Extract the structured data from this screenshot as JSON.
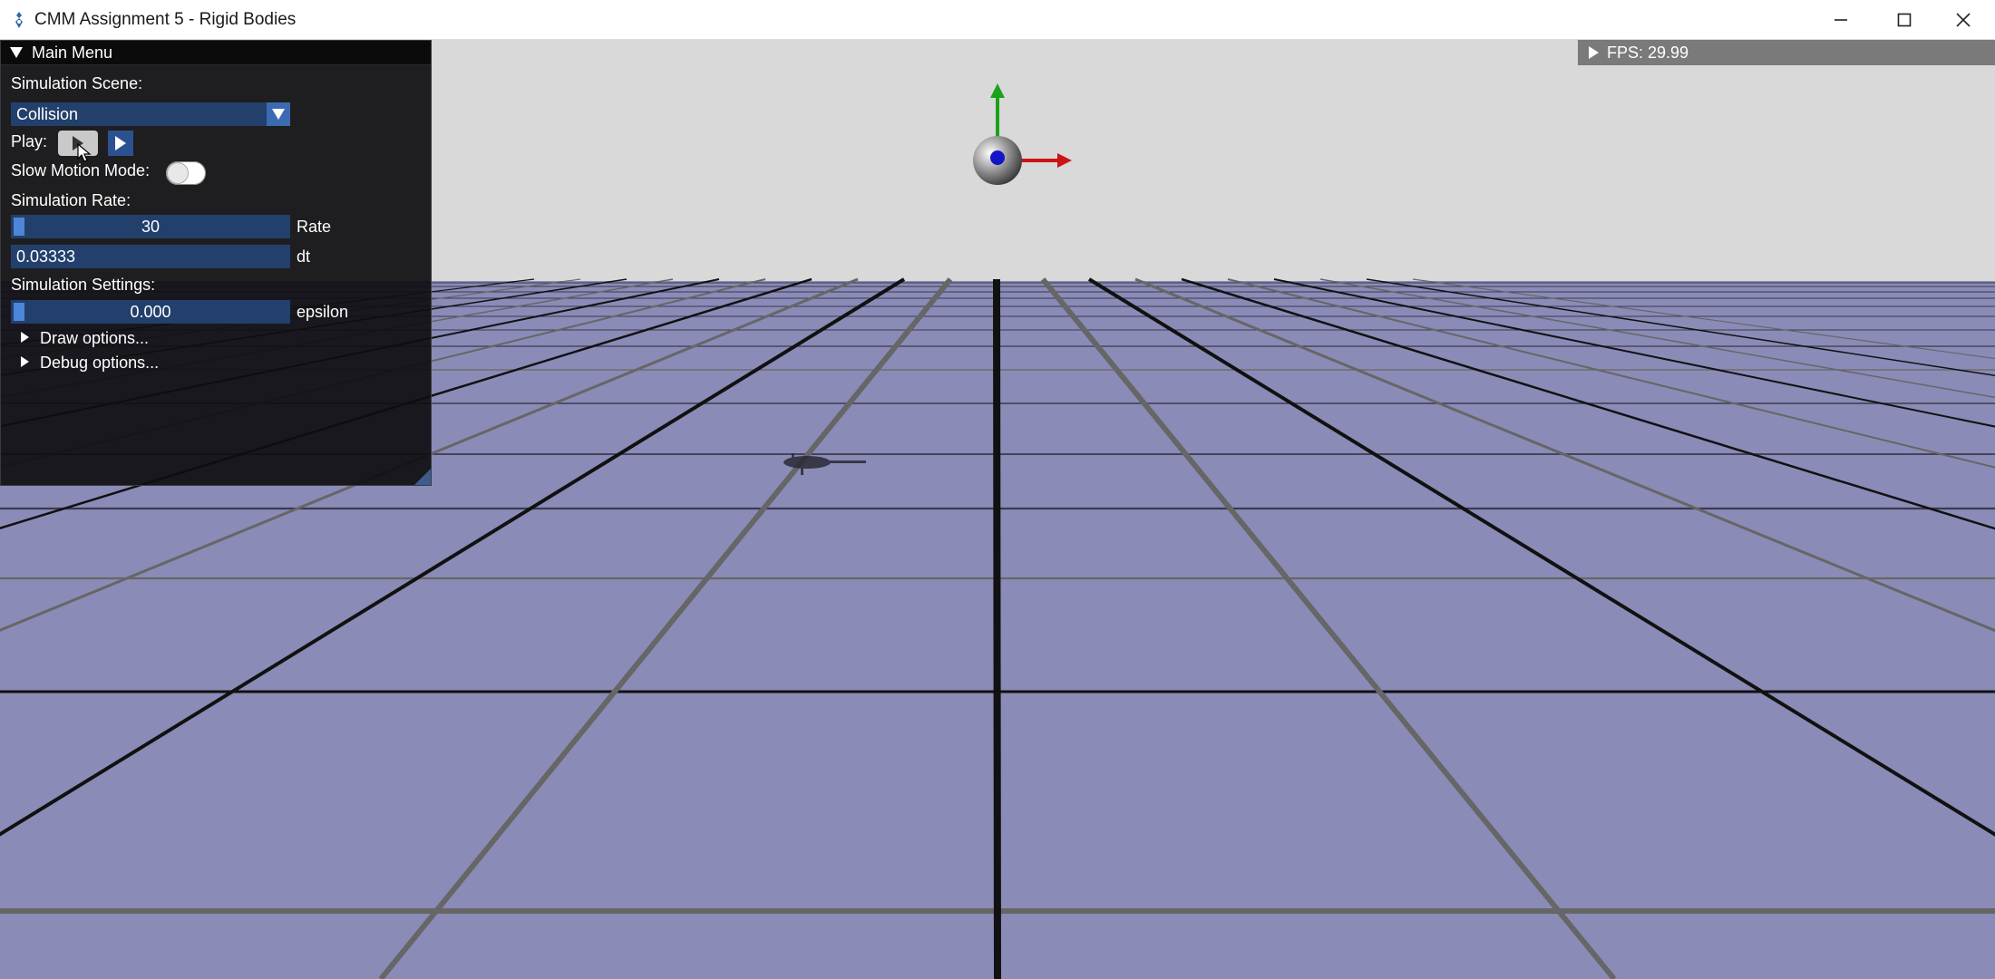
{
  "window": {
    "title": "CMM Assignment 5 - Rigid Bodies",
    "controls": [
      "minimize",
      "maximize",
      "close"
    ]
  },
  "overlay": {
    "fps_label": "FPS: 29.99"
  },
  "menu": {
    "header": "Main Menu",
    "scene_label": "Simulation Scene:",
    "scene_value": "Collision",
    "play_label": "Play:",
    "slow_motion_label": "Slow Motion Mode:",
    "slow_motion_on": false,
    "rate_label": "Simulation Rate:",
    "rate_value": "30",
    "rate_suffix": "Rate",
    "dt_value": "0.03333",
    "dt_suffix": "dt",
    "settings_label": "Simulation Settings:",
    "epsilon_value": "0.000",
    "epsilon_suffix": "epsilon",
    "draw_options": "Draw options...",
    "debug_options": "Debug options..."
  },
  "colors": {
    "sky": "#d9d9d9",
    "ground": "#8b8bb8",
    "panel_bg": "#0e0e10",
    "widget_bg": "#23406c",
    "accent": "#4d86d8"
  }
}
